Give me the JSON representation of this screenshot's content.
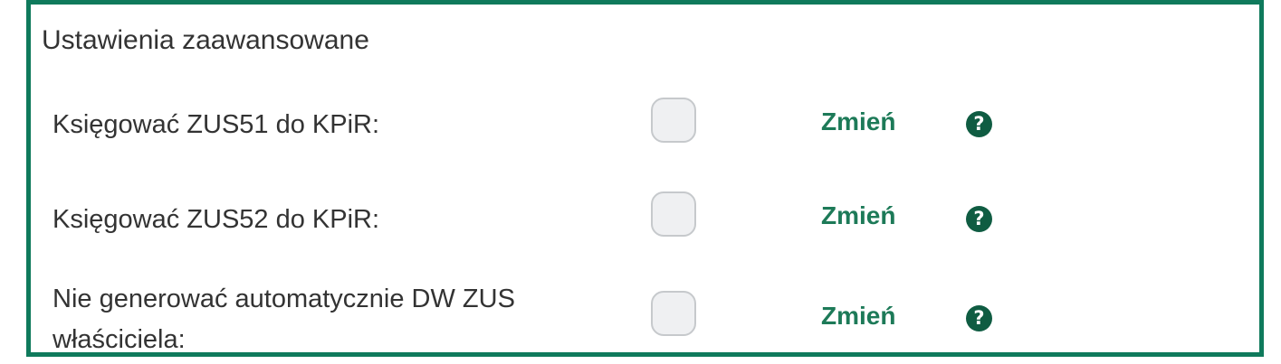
{
  "section": {
    "title": "Ustawienia zaawansowane"
  },
  "rows": [
    {
      "label": "Księgować ZUS51 do KPiR:",
      "checked": false,
      "action_label": "Zmień",
      "help_glyph": "?"
    },
    {
      "label": "Księgować ZUS52 do KPiR:",
      "checked": false,
      "action_label": "Zmień",
      "help_glyph": "?"
    },
    {
      "label_line1": "Nie generować automatycznie DW ZUS",
      "label_line2": "właściciela:",
      "checked": false,
      "action_label": "Zmień",
      "help_glyph": "?"
    }
  ],
  "colors": {
    "border": "#0f7a5c",
    "link": "#1d7a58",
    "help_icon": "#0f5c42",
    "checkbox_bg": "#eff0f2"
  },
  "icons": {
    "help": "question-circle-icon"
  }
}
